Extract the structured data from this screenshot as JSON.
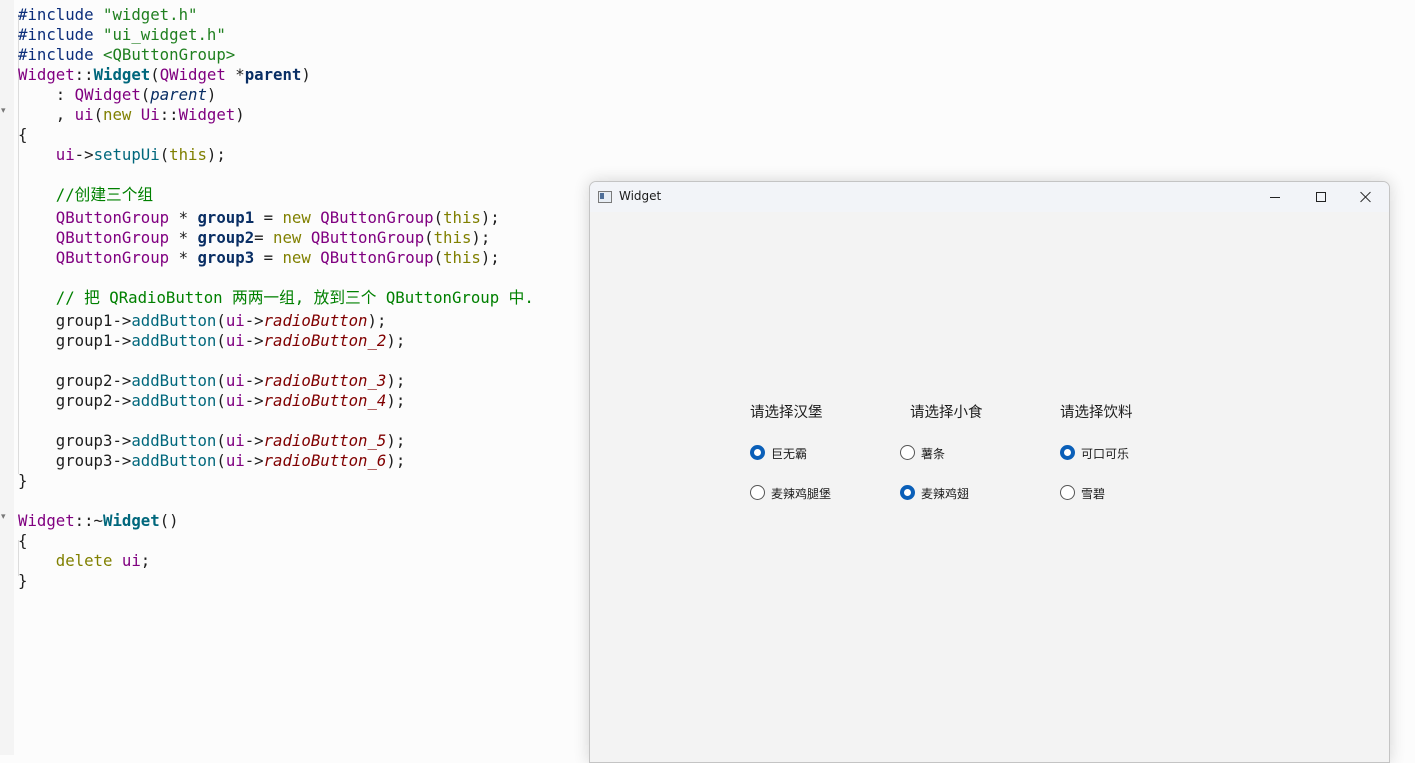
{
  "editor": {
    "lines": [
      [
        [
          "pp",
          "#include "
        ],
        [
          "inc",
          "\"widget.h\""
        ]
      ],
      [
        [
          "pp",
          "#include "
        ],
        [
          "inc",
          "\"ui_widget.h\""
        ]
      ],
      [
        [
          "pp",
          "#include "
        ],
        [
          "inc",
          "<QButtonGroup>"
        ]
      ],
      [
        [
          "cls",
          "Widget"
        ],
        [
          "op",
          "::"
        ],
        [
          "fnb",
          "Widget"
        ],
        [
          "op",
          "("
        ],
        [
          "cls",
          "QWidget"
        ],
        [
          "op",
          " *"
        ],
        [
          "prm",
          "parent"
        ],
        [
          "op",
          ")"
        ]
      ],
      [
        [
          "op",
          "    : "
        ],
        [
          "cls",
          "QWidget"
        ],
        [
          "op",
          "("
        ],
        [
          "prmi",
          "parent"
        ],
        [
          "op",
          ")"
        ]
      ],
      [
        [
          "op",
          "    , "
        ],
        [
          "cls",
          "ui"
        ],
        [
          "op",
          "("
        ],
        [
          "kw",
          "new "
        ],
        [
          "cls",
          "Ui"
        ],
        [
          "op",
          "::"
        ],
        [
          "cls",
          "Widget"
        ],
        [
          "op",
          ")"
        ]
      ],
      [
        [
          "op",
          "{"
        ]
      ],
      [
        [
          "op",
          "    "
        ],
        [
          "cls",
          "ui"
        ],
        [
          "op",
          "->"
        ],
        [
          "fn",
          "setupUi"
        ],
        [
          "op",
          "("
        ],
        [
          "kw",
          "this"
        ],
        [
          "op",
          ");"
        ]
      ],
      [],
      [
        [
          "op",
          "    "
        ],
        [
          "cm",
          "//创建三个组"
        ]
      ],
      [
        [
          "op",
          "    "
        ],
        [
          "cls",
          "QButtonGroup"
        ],
        [
          "op",
          " * "
        ],
        [
          "var",
          "group1"
        ],
        [
          "op",
          " = "
        ],
        [
          "kw",
          "new "
        ],
        [
          "cls",
          "QButtonGroup"
        ],
        [
          "op",
          "("
        ],
        [
          "kw",
          "this"
        ],
        [
          "op",
          ");"
        ]
      ],
      [
        [
          "op",
          "    "
        ],
        [
          "cls",
          "QButtonGroup"
        ],
        [
          "op",
          " * "
        ],
        [
          "var",
          "group2"
        ],
        [
          "op",
          "= "
        ],
        [
          "kw",
          "new "
        ],
        [
          "cls",
          "QButtonGroup"
        ],
        [
          "op",
          "("
        ],
        [
          "kw",
          "this"
        ],
        [
          "op",
          ");"
        ]
      ],
      [
        [
          "op",
          "    "
        ],
        [
          "cls",
          "QButtonGroup"
        ],
        [
          "op",
          " * "
        ],
        [
          "var",
          "group3"
        ],
        [
          "op",
          " = "
        ],
        [
          "kw",
          "new "
        ],
        [
          "cls",
          "QButtonGroup"
        ],
        [
          "op",
          "("
        ],
        [
          "kw",
          "this"
        ],
        [
          "op",
          ");"
        ]
      ],
      [],
      [
        [
          "op",
          "    "
        ],
        [
          "cm",
          "// 把 QRadioButton 两两一组, 放到三个 QButtonGroup 中."
        ]
      ],
      [
        [
          "op",
          "    "
        ],
        [
          "op",
          "group1->"
        ],
        [
          "fn",
          "addButton"
        ],
        [
          "op",
          "("
        ],
        [
          "cls",
          "ui"
        ],
        [
          "op",
          "->"
        ],
        [
          "mem",
          "radioButton"
        ],
        [
          "op",
          ");"
        ]
      ],
      [
        [
          "op",
          "    "
        ],
        [
          "op",
          "group1->"
        ],
        [
          "fn",
          "addButton"
        ],
        [
          "op",
          "("
        ],
        [
          "cls",
          "ui"
        ],
        [
          "op",
          "->"
        ],
        [
          "mem",
          "radioButton_2"
        ],
        [
          "op",
          ");"
        ]
      ],
      [],
      [
        [
          "op",
          "    "
        ],
        [
          "op",
          "group2->"
        ],
        [
          "fn",
          "addButton"
        ],
        [
          "op",
          "("
        ],
        [
          "cls",
          "ui"
        ],
        [
          "op",
          "->"
        ],
        [
          "mem",
          "radioButton_3"
        ],
        [
          "op",
          ");"
        ]
      ],
      [
        [
          "op",
          "    "
        ],
        [
          "op",
          "group2->"
        ],
        [
          "fn",
          "addButton"
        ],
        [
          "op",
          "("
        ],
        [
          "cls",
          "ui"
        ],
        [
          "op",
          "->"
        ],
        [
          "mem",
          "radioButton_4"
        ],
        [
          "op",
          ");"
        ]
      ],
      [],
      [
        [
          "op",
          "    "
        ],
        [
          "op",
          "group3->"
        ],
        [
          "fn",
          "addButton"
        ],
        [
          "op",
          "("
        ],
        [
          "cls",
          "ui"
        ],
        [
          "op",
          "->"
        ],
        [
          "mem",
          "radioButton_5"
        ],
        [
          "op",
          ");"
        ]
      ],
      [
        [
          "op",
          "    "
        ],
        [
          "op",
          "group3->"
        ],
        [
          "fn",
          "addButton"
        ],
        [
          "op",
          "("
        ],
        [
          "cls",
          "ui"
        ],
        [
          "op",
          "->"
        ],
        [
          "mem",
          "radioButton_6"
        ],
        [
          "op",
          ");"
        ]
      ],
      [
        [
          "op",
          "}"
        ]
      ],
      [],
      [
        [
          "cls",
          "Widget"
        ],
        [
          "op",
          "::~"
        ],
        [
          "fnb",
          "Widget"
        ],
        [
          "op",
          "()"
        ]
      ],
      [
        [
          "op",
          "{"
        ]
      ],
      [
        [
          "op",
          "    "
        ],
        [
          "kw",
          "delete "
        ],
        [
          "cls",
          "ui"
        ],
        [
          "op",
          ";"
        ]
      ],
      [
        [
          "op",
          "}"
        ]
      ]
    ]
  },
  "window": {
    "title": "Widget",
    "icon": "app-window-icon",
    "controls": [
      "minimize-icon",
      "maximize-icon",
      "close-icon"
    ],
    "groups": [
      {
        "label": "请选择汉堡",
        "options": [
          {
            "text": "巨无霸",
            "checked": true
          },
          {
            "text": "麦辣鸡腿堡",
            "checked": false
          }
        ]
      },
      {
        "label": "请选择小食",
        "options": [
          {
            "text": "薯条",
            "checked": false
          },
          {
            "text": "麦辣鸡翅",
            "checked": true
          }
        ]
      },
      {
        "label": "请选择饮料",
        "options": [
          {
            "text": "可口可乐",
            "checked": true
          },
          {
            "text": "雪碧",
            "checked": false
          }
        ]
      }
    ]
  },
  "colors": {
    "radio_checked": "#0a5fb8",
    "window_bg": "#f3f3f3",
    "editor_bg": "#fcfcfc"
  }
}
